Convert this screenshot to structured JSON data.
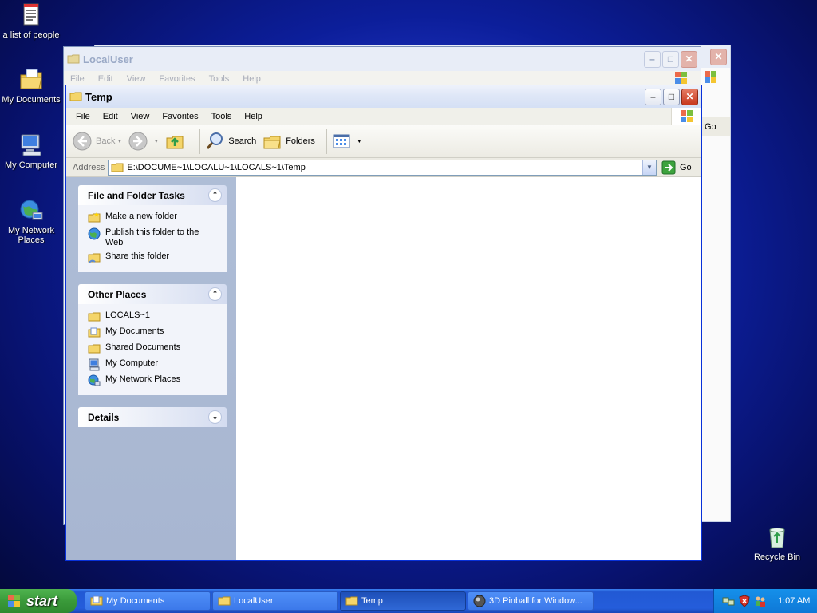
{
  "desktop": {
    "icons": [
      {
        "label": "a list of people",
        "icon": "text-document-icon"
      },
      {
        "label": "My Documents",
        "icon": "my-documents-icon"
      },
      {
        "label": "My Computer",
        "icon": "my-computer-icon"
      },
      {
        "label": "My Network Places",
        "icon": "network-places-icon"
      },
      {
        "label": "Recycle Bin",
        "icon": "recycle-bin-icon"
      }
    ]
  },
  "back_window": {
    "title": "LocalUser",
    "menu": [
      "File",
      "Edit",
      "View",
      "Favorites",
      "Tools",
      "Help"
    ],
    "go_label": "Go"
  },
  "window": {
    "title": "Temp",
    "menu": [
      "File",
      "Edit",
      "View",
      "Favorites",
      "Tools",
      "Help"
    ],
    "toolbar": {
      "back": "Back",
      "search": "Search",
      "folders": "Folders"
    },
    "address": {
      "label": "Address",
      "value": "E:\\DOCUME~1\\LOCALU~1\\LOCALS~1\\Temp",
      "go": "Go"
    },
    "taskpane": {
      "file_tasks": {
        "title": "File and Folder Tasks",
        "items": [
          "Make a new folder",
          "Publish this folder to the Web",
          "Share this folder"
        ]
      },
      "other_places": {
        "title": "Other Places",
        "items": [
          "LOCALS~1",
          "My Documents",
          "Shared Documents",
          "My Computer",
          "My Network Places"
        ]
      },
      "details": {
        "title": "Details"
      }
    }
  },
  "taskbar": {
    "start": "start",
    "tasks": [
      {
        "label": "My Documents",
        "active": false
      },
      {
        "label": "LocalUser",
        "active": false
      },
      {
        "label": "Temp",
        "active": true
      },
      {
        "label": "3D Pinball for Window...",
        "active": false
      }
    ],
    "clock": "1:07 AM"
  }
}
